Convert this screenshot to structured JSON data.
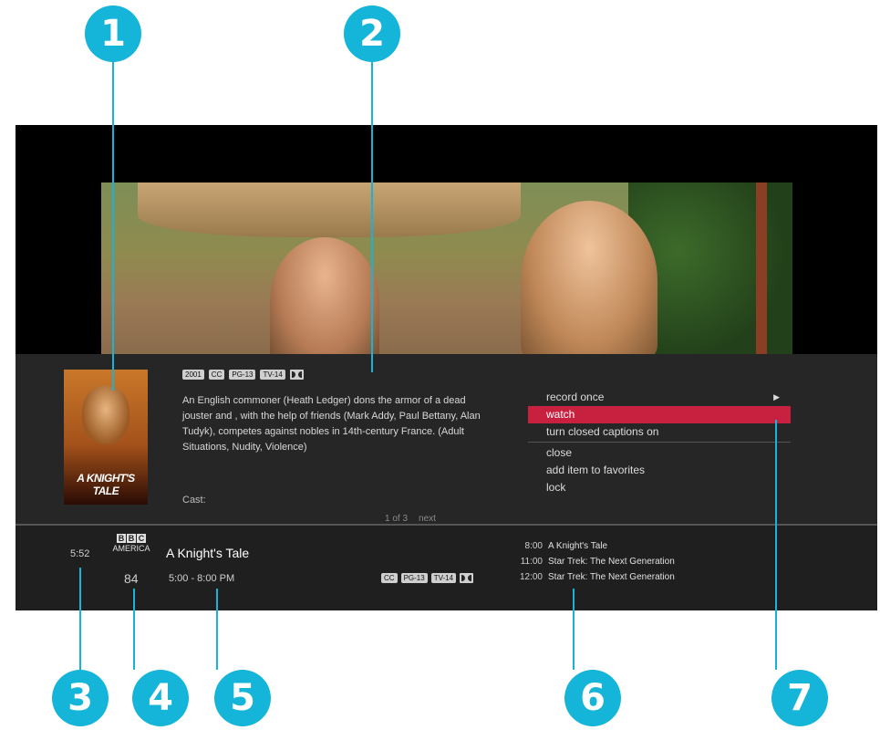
{
  "callouts": [
    "1",
    "2",
    "3",
    "4",
    "5",
    "6",
    "7"
  ],
  "program": {
    "year": "2001",
    "badges": [
      "CC",
      "PG-13",
      "TV-14"
    ],
    "synopsis": "An English commoner (Heath Ledger) dons the armor of a dead jouster and , with the help of friends (Mark Addy, Paul Bettany, Alan Tudyk), competes against nobles in 14th-century France. (Adult Situations, Nudity, Violence)",
    "cast_label": "Cast:",
    "poster_title": "A KNIGHT'S TALE",
    "page": "1 of 3",
    "next": "next"
  },
  "menu": {
    "items": [
      "record once",
      "watch",
      "turn closed captions on",
      "close",
      "add item to favorites",
      "lock"
    ],
    "selected": "watch",
    "accent": "#c8203f"
  },
  "channel": {
    "clock": "5:52",
    "logo_letters": [
      "B",
      "B",
      "C"
    ],
    "logo_sub": "AMERICA",
    "title": "A Knight's Tale",
    "number": "84",
    "time": "5:00 - 8:00 PM",
    "badges": [
      "CC",
      "PG-13",
      "TV-14"
    ]
  },
  "upcoming": [
    {
      "time": "8:00",
      "title": "A Knight's Tale"
    },
    {
      "time": "11:00",
      "title": "Star Trek: The Next Generation"
    },
    {
      "time": "12:00",
      "title": "Star Trek: The Next Generation"
    }
  ],
  "colors": {
    "callout": "#15b4d9",
    "panel": "#262626",
    "guide": "#1f1f1f"
  }
}
